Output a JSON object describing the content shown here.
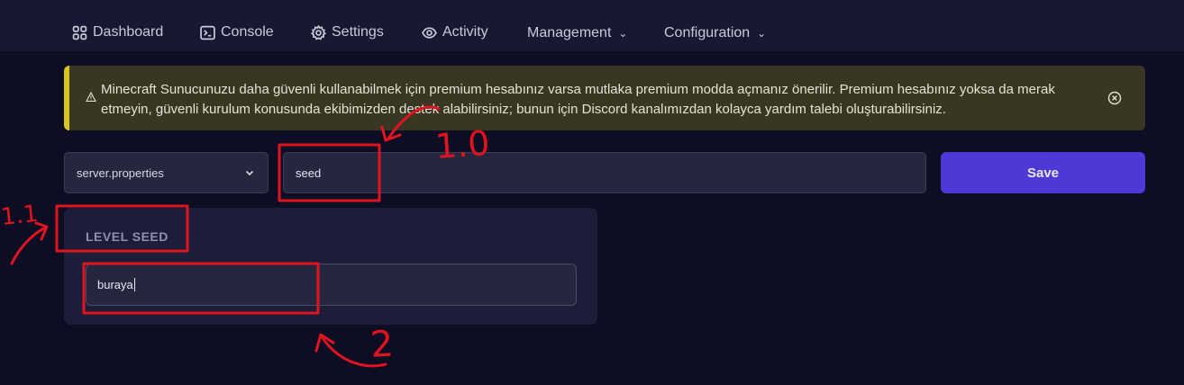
{
  "nav": {
    "items": [
      {
        "label": "Dashboard",
        "icon": "grid-icon"
      },
      {
        "label": "Console",
        "icon": "terminal-icon"
      },
      {
        "label": "Settings",
        "icon": "gear-icon"
      },
      {
        "label": "Activity",
        "icon": "eye-icon"
      },
      {
        "label": "Management",
        "icon": "chevron-down-icon"
      },
      {
        "label": "Configuration",
        "icon": "chevron-down-icon"
      }
    ]
  },
  "alert": {
    "text": "Minecraft Sunucunuzu daha güvenli kullanabilmek için premium hesabınız varsa mutlaka premium modda açmanız önerilir. Premium hesabınız yoksa da merak etmeyin, güvenli kurulum konusunda ekibimizden destek alabilirsiniz; bunun için Discord kanalımızdan kolayca yardım talebi oluşturabilirsiniz.",
    "color": "#d9c61a"
  },
  "file_select": {
    "value": "server.properties"
  },
  "search": {
    "value": "seed"
  },
  "save_button": {
    "label": "Save",
    "color": "#4f39d6"
  },
  "property": {
    "label": "LEVEL SEED",
    "value": "buraya"
  },
  "annotations": {
    "color": "#e0141e",
    "labels": [
      "1.0",
      "1.1",
      "2"
    ]
  }
}
